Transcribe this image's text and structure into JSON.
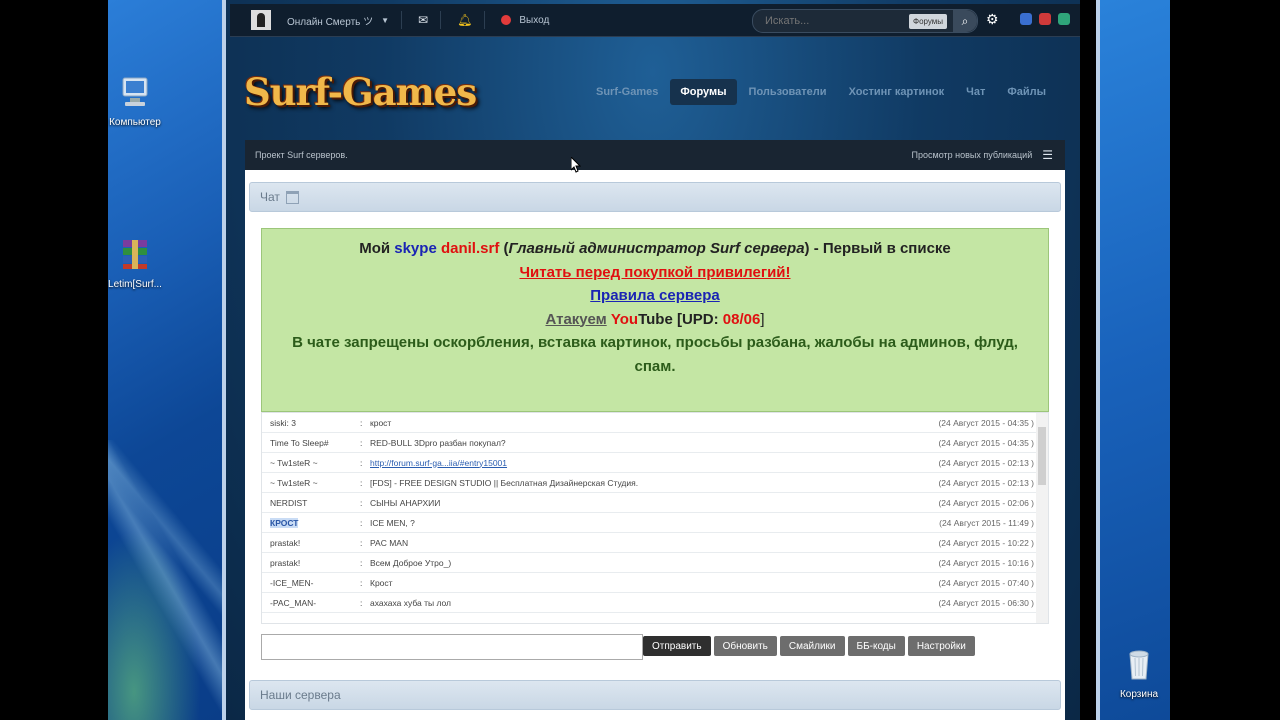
{
  "desktop": {
    "icons": [
      {
        "label": "Компьютер",
        "icon": "computer-icon"
      },
      {
        "label": "Letim[Surf...",
        "icon": "winrar-archive-icon"
      },
      {
        "label": "Корзина",
        "icon": "recycle-bin-icon"
      }
    ]
  },
  "topbar": {
    "user": "Онлайн Смерть ツ",
    "logout": "Выход",
    "search_placeholder": "Искать...",
    "search_scope": "Форумы"
  },
  "site": {
    "logo": "Surf-Games",
    "nav": [
      "Surf-Games",
      "Форумы",
      "Пользователи",
      "Хостинг картинок",
      "Чат",
      "Файлы"
    ],
    "active_nav": "Форумы"
  },
  "breadcrumb": {
    "left": "Проект Surf серверов.",
    "right": "Просмотр новых публикаций"
  },
  "chat_section": {
    "title": "Чат",
    "notice": {
      "line1_a": "Мой ",
      "line1_skype": "skype",
      "line1_b": " ",
      "line1_name": "danil.srf",
      "line1_c": " (",
      "line1_role": "Главный администратор Surf сервера",
      "line1_d": ") - Первый в списке",
      "line2": "Читать перед покупкой привилегий!",
      "line3": "Правила сервера",
      "line4_a": "Атакуем",
      "line4_you": "You",
      "line4_tube": "Tube [UPD: ",
      "line4_date": "08/06",
      "line4_end": "]",
      "line5": "В чате запрещены оскорбления, вставка картинок, просьбы разбана, жалобы на админов, флуд, спам."
    },
    "messages": [
      {
        "user": "siski: 3",
        "text": "крост",
        "date": "(24 Август 2015 - 04:35 )"
      },
      {
        "user": "Time To Sleep#",
        "text": "RED-BULL 3Dpro разбан покупал?",
        "date": "(24 Август 2015 - 04:35 )"
      },
      {
        "user": "~ Tw1steR ~",
        "text": "http://forum.surf-ga...iia/#entry15001",
        "date": "(24 Август 2015 - 02:13 )",
        "link": true
      },
      {
        "user": "~ Tw1steR ~",
        "text": "[FDS] - FREE DESIGN STUDIO || Бесплатная Дизайнерская Студия.",
        "date": "(24 Август 2015 - 02:13 )"
      },
      {
        "user": "NERDIST",
        "text": "СЫНЫ АНАРХИИ",
        "date": "(24 Август 2015 - 02:06 )"
      },
      {
        "user": "КРОСТ",
        "text": "ICE MEN, ?",
        "date": "(24 Август 2015 - 11:49 )",
        "highlight": true
      },
      {
        "user": "prastak!",
        "text": "PAC MAN",
        "date": "(24 Август 2015 - 10:22 )"
      },
      {
        "user": "prastak!",
        "text": "Всем Доброе Утро_)",
        "date": "(24 Август 2015 - 10:16 )"
      },
      {
        "user": "-ICE_MEN-",
        "text": "Крост",
        "date": "(24 Август 2015 - 07:40 )"
      },
      {
        "user": "-PAC_MAN-",
        "text": "ахахаха хуба ты лол",
        "date": "(24 Август 2015 - 06:30 )"
      }
    ],
    "buttons": [
      "Отправить",
      "Обновить",
      "Смайлики",
      "ББ-коды",
      "Настройки"
    ]
  },
  "servers_section": {
    "title": "Наши сервера"
  }
}
